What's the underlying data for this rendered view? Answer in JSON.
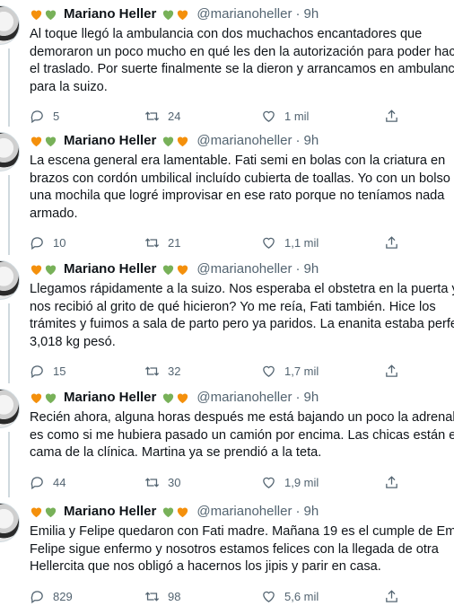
{
  "colors": {
    "orange_heart": "#f4900c",
    "green_heart": "#78b159",
    "secondary_text": "#536471"
  },
  "icons": {
    "reply": "reply-icon",
    "retweet": "retweet-icon",
    "like": "heart-icon",
    "share": "share-icon"
  },
  "tweets": [
    {
      "name": "Mariano Heller",
      "handle": "@marianoheller",
      "separator": "·",
      "time": "9h",
      "lines": [
        "Al toque llegó la ambulancia con dos muchachos encantadores que",
        "demoraron un poco mucho en qué les den la autorización para poder hac",
        "el traslado. Por suerte finalmente se la dieron y arrancamos en ambulanci",
        "para la suizo."
      ],
      "replies": "5",
      "retweets": "24",
      "likes": "1 mil"
    },
    {
      "name": "Mariano Heller",
      "handle": "@marianoheller",
      "separator": "·",
      "time": "9h",
      "lines": [
        "La escena general era lamentable. Fati semi en bolas con la criatura en",
        "brazos con cordón umbilical incluído cubierta de toallas. Yo con un bolso",
        "una mochila que logré improvisar en ese rato porque no teníamos nada",
        "armado."
      ],
      "replies": "10",
      "retweets": "21",
      "likes": "1,1 mil"
    },
    {
      "name": "Mariano Heller",
      "handle": "@marianoheller",
      "separator": "·",
      "time": "9h",
      "lines": [
        "Llegamos rápidamente a la suizo. Nos esperaba el obstetra en la puerta y",
        "nos recibió al grito de qué hicieron? Yo me reía, Fati también. Hice los",
        "trámites y fuimos a sala de parto pero ya paridos. La enanita estaba perfe",
        "3,018 kg pesó."
      ],
      "replies": "15",
      "retweets": "32",
      "likes": "1,7 mil"
    },
    {
      "name": "Mariano Heller",
      "handle": "@marianoheller",
      "separator": "·",
      "time": "9h",
      "lines": [
        "Recién ahora, alguna horas después me está bajando un poco la adrenalin",
        "es como si me hubiera pasado un camión por encima. Las chicas están en",
        "cama de la clínica. Martina ya se prendió a la teta."
      ],
      "replies": "44",
      "retweets": "30",
      "likes": "1,9 mil"
    },
    {
      "name": "Mariano Heller",
      "handle": "@marianoheller",
      "separator": "·",
      "time": "9h",
      "lines": [
        "Emilia y Felipe quedaron con Fati madre. Mañana 19 es el cumple de Emil",
        "Felipe sigue enfermo y nosotros estamos felices con la llegada de otra",
        "Hellercita que nos obligó a hacernos los jipis y parir en casa."
      ],
      "replies": "829",
      "retweets": "98",
      "likes": "5,6 mil"
    }
  ]
}
